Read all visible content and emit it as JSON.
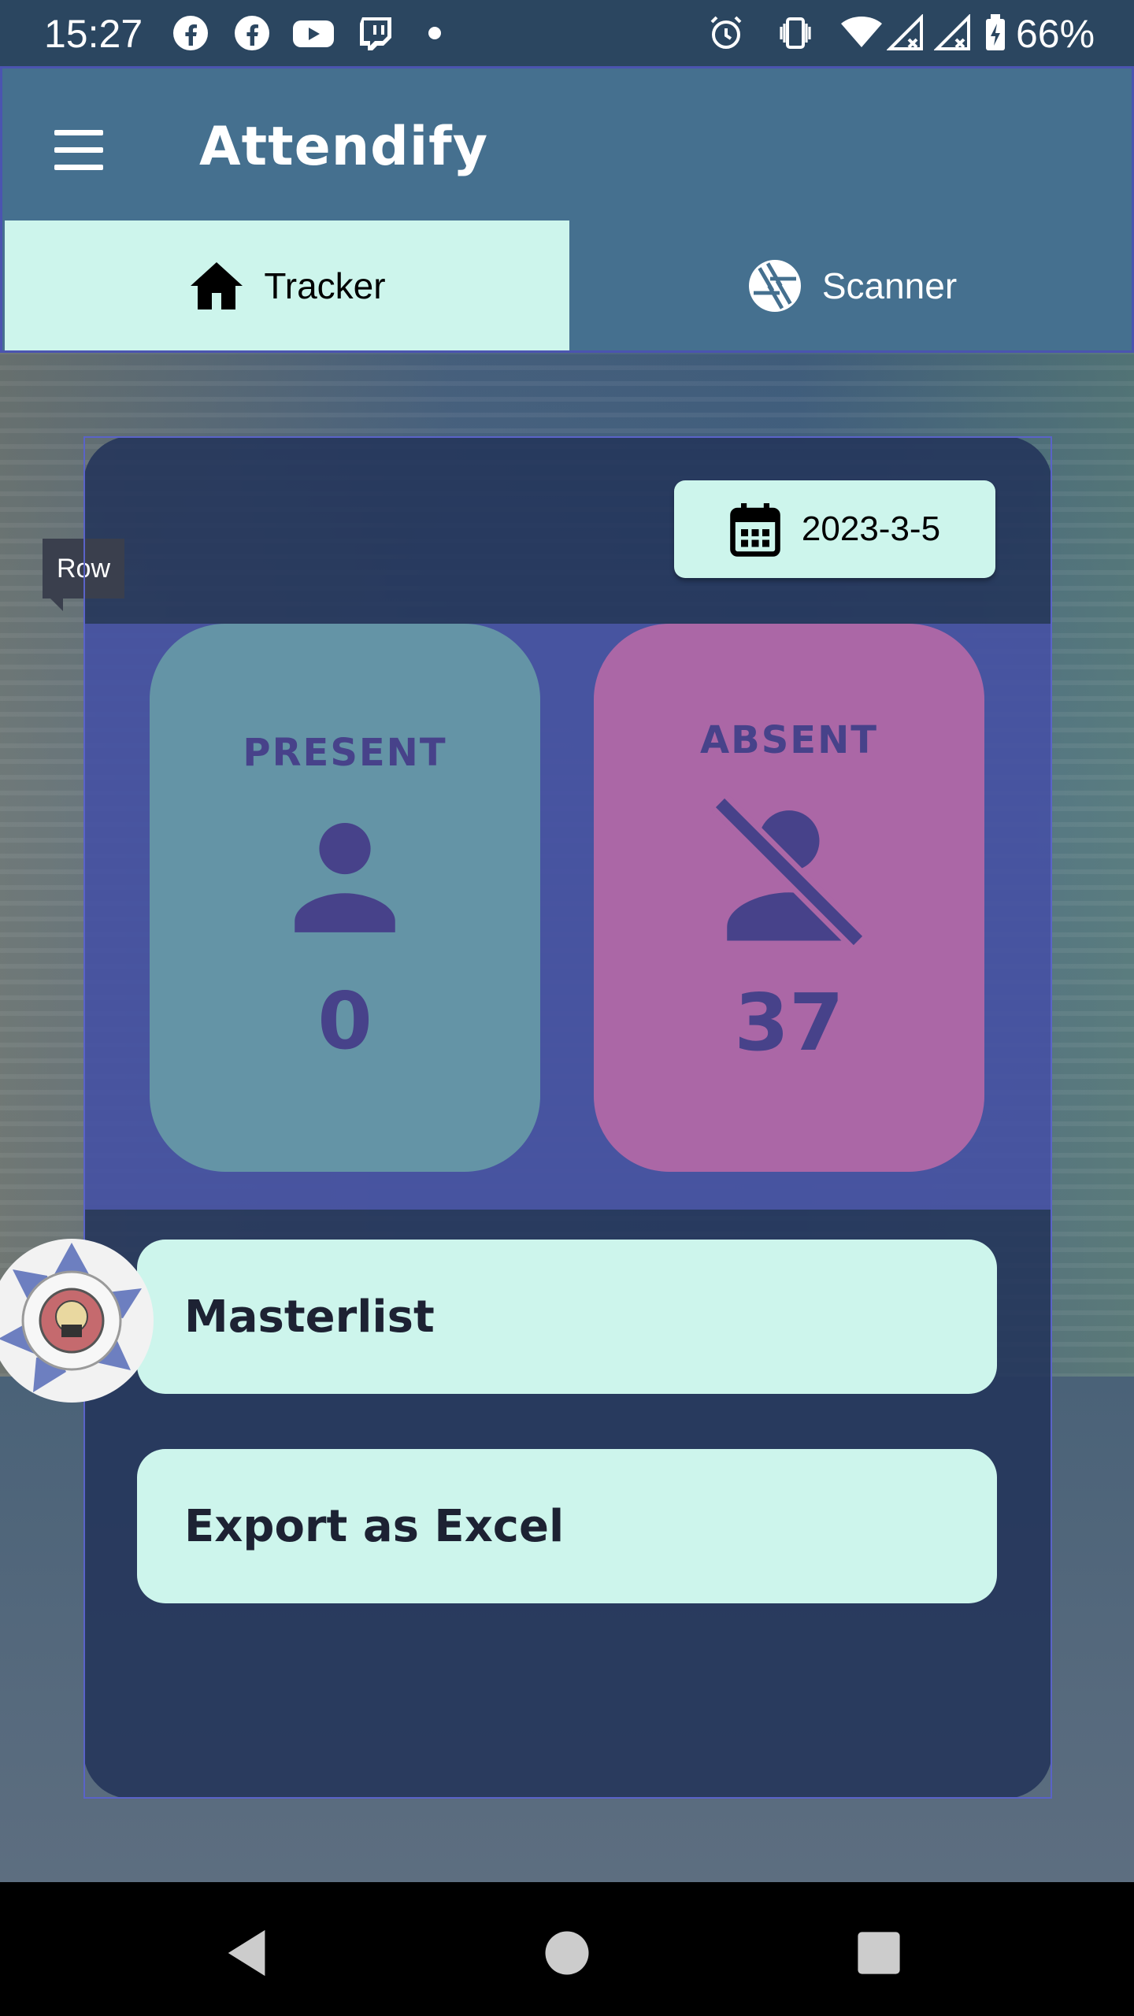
{
  "status_bar": {
    "time": "15:27",
    "battery": "66%",
    "icons": [
      "facebook-icon",
      "facebook-icon",
      "youtube-icon",
      "twitch-icon",
      "dot-icon",
      "alarm-icon",
      "vibrate-icon",
      "wifi-icon",
      "signal-icon",
      "signal-icon",
      "battery-charging-icon"
    ]
  },
  "app_bar": {
    "title": "Attendify",
    "menu_icon": "hamburger-menu-icon"
  },
  "tabs": [
    {
      "label": "Tracker",
      "icon": "home-icon",
      "active": true
    },
    {
      "label": "Scanner",
      "icon": "camera-shutter-icon",
      "active": false
    }
  ],
  "tracker": {
    "date": "2023-3-5",
    "date_icon": "calendar-icon",
    "row_tooltip": "Row",
    "present": {
      "label": "PRESENT",
      "count": "0",
      "icon": "person-icon"
    },
    "absent": {
      "label": "ABSENT",
      "count": "37",
      "icon": "person-off-icon"
    },
    "buttons": {
      "masterlist": "Masterlist",
      "export": "Export as Excel"
    }
  },
  "logo": {
    "name": "ict-shs-seal"
  },
  "nav": {
    "back": "back-icon",
    "home": "home-circle-icon",
    "recents": "recents-icon"
  },
  "colors": {
    "app_bar": "#45708f",
    "tab_active": "#cdf5ec",
    "present_card": "#6494a6",
    "absent_card": "#ab67a6",
    "card_text": "#47428a",
    "row_highlight": "#5a64c8"
  }
}
